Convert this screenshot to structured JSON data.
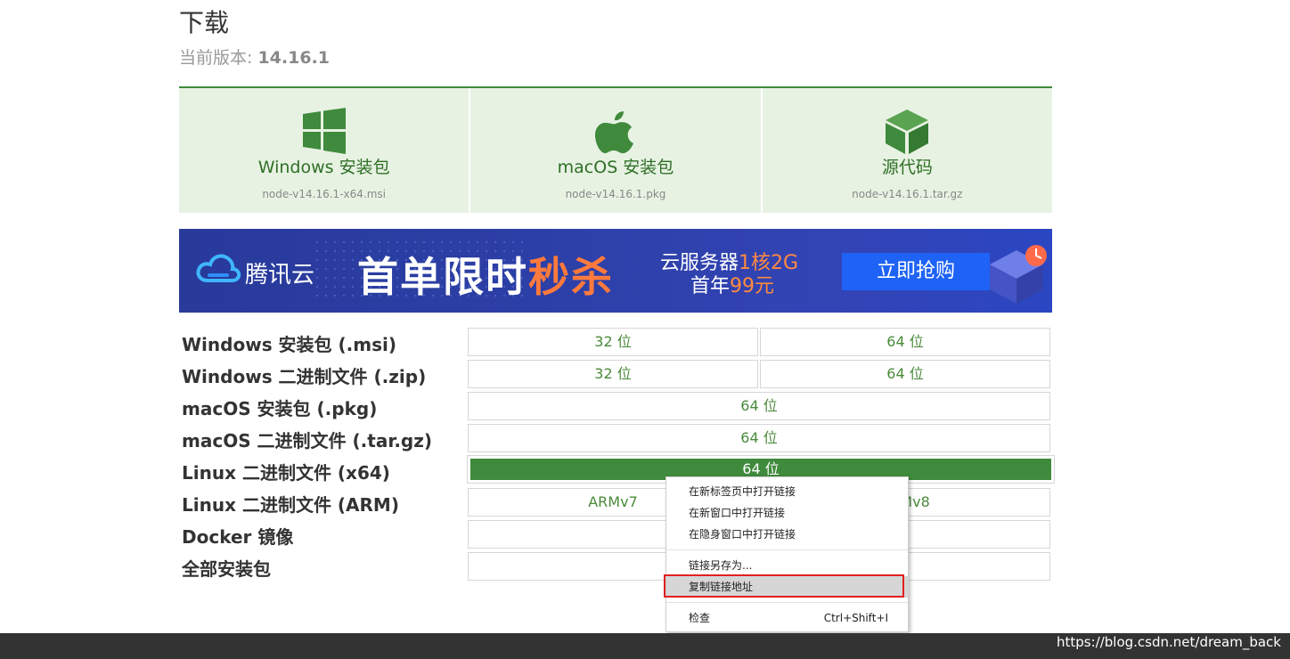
{
  "header": {
    "title": "下载",
    "version_label": "当前版本: ",
    "version_value": "14.16.1"
  },
  "downloads": [
    {
      "icon": "windows-icon",
      "label": "Windows 安装包",
      "file": "node-v14.16.1-x64.msi"
    },
    {
      "icon": "apple-icon",
      "label": "macOS 安装包",
      "file": "node-v14.16.1.pkg"
    },
    {
      "icon": "source-box-icon",
      "label": "源代码",
      "file": "node-v14.16.1.tar.gz"
    }
  ],
  "banner": {
    "brand": "腾讯云",
    "slogan_a": "首单限时",
    "slogan_b": "秒杀",
    "spec1_a": "云服务器",
    "spec1_b": "1核2G",
    "spec2_a": "首年",
    "spec2_b": "99元",
    "button": "立即抢购",
    "colors": {
      "background": "#2c3fa6",
      "accent": "#ff7a3c",
      "button": "#1e63f5"
    }
  },
  "table": {
    "rows": [
      {
        "label": "Windows 安装包 (.msi)",
        "cells": [
          "32 位",
          "64 位"
        ]
      },
      {
        "label": "Windows 二进制文件 (.zip)",
        "cells": [
          "32 位",
          "64 位"
        ]
      },
      {
        "label": "macOS 安装包 (.pkg)",
        "cells": [
          "64 位"
        ]
      },
      {
        "label": "macOS 二进制文件 (.tar.gz)",
        "cells": [
          "64 位"
        ]
      },
      {
        "label": "Linux 二进制文件 (x64)",
        "cells": [
          "64 位"
        ]
      },
      {
        "label": "Linux 二进制文件 (ARM)",
        "cells": [
          "ARMv7",
          "ARMv8"
        ]
      },
      {
        "label": "Docker 镜像",
        "cells": [
          ""
        ]
      },
      {
        "label": "全部安装包",
        "cells": [
          ""
        ]
      }
    ],
    "colors": {
      "link": "#4a8a3a",
      "active_bg": "#3f8a3c"
    }
  },
  "context_menu": {
    "items": [
      "在新标签页中打开链接",
      "在新窗口中打开链接",
      "在隐身窗口中打开链接",
      "链接另存为...",
      "复制链接地址",
      "检查"
    ],
    "inspect_shortcut": "Ctrl+Shift+I",
    "highlight_color": "#e02020"
  },
  "footer": {
    "watermark": "https://blog.csdn.net/dream_back"
  }
}
